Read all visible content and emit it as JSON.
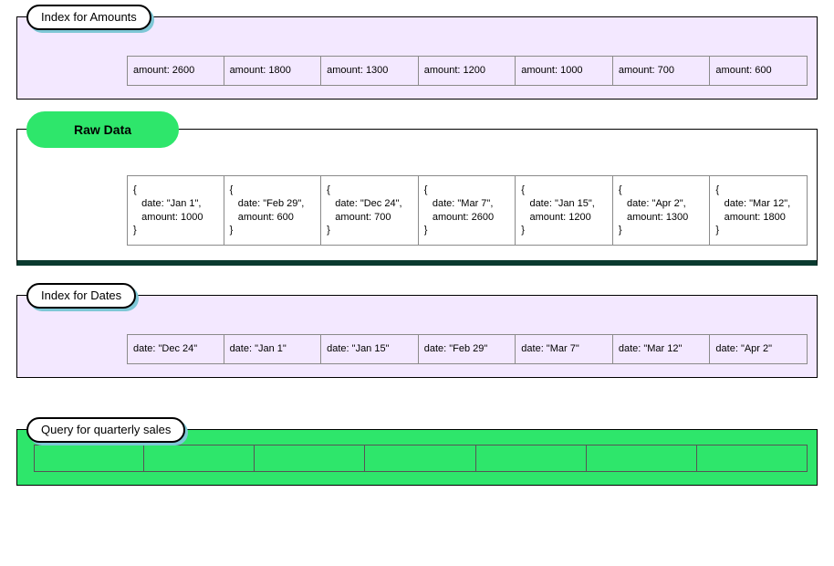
{
  "index_amounts": {
    "title": "Index for Amounts",
    "cells": [
      "amount: 2600",
      "amount: 1800",
      "amount: 1300",
      "amount: 1200",
      "amount: 1000",
      "amount: 700",
      "amount: 600"
    ]
  },
  "raw_data": {
    "title": "Raw Data",
    "cells": [
      "{\n   date: \"Jan 1\",\n   amount: 1000\n}",
      "{\n   date: \"Feb 29\",\n   amount: 600\n}",
      "{\n   date: \"Dec 24\",\n   amount: 700\n}",
      "{\n   date: \"Mar 7\",\n   amount: 2600\n}",
      "{\n   date: \"Jan 15\",\n   amount: 1200\n}",
      "{\n   date: \"Apr 2\",\n   amount: 1300\n}",
      "{\n   date: \"Mar 12\",\n   amount: 1800\n}"
    ]
  },
  "index_dates": {
    "title": "Index for Dates",
    "cells": [
      "date: \"Dec 24\"",
      "date: \"Jan 1\"",
      "date: \"Jan 15\"",
      "date: \"Feb 29\"",
      "date: \"Mar 7\"",
      "date: \"Mar 12\"",
      "date: \"Apr 2\""
    ]
  },
  "query": {
    "title": "Query for quarterly sales",
    "cells": [
      "",
      "",
      "",
      "",
      "",
      "",
      ""
    ]
  }
}
